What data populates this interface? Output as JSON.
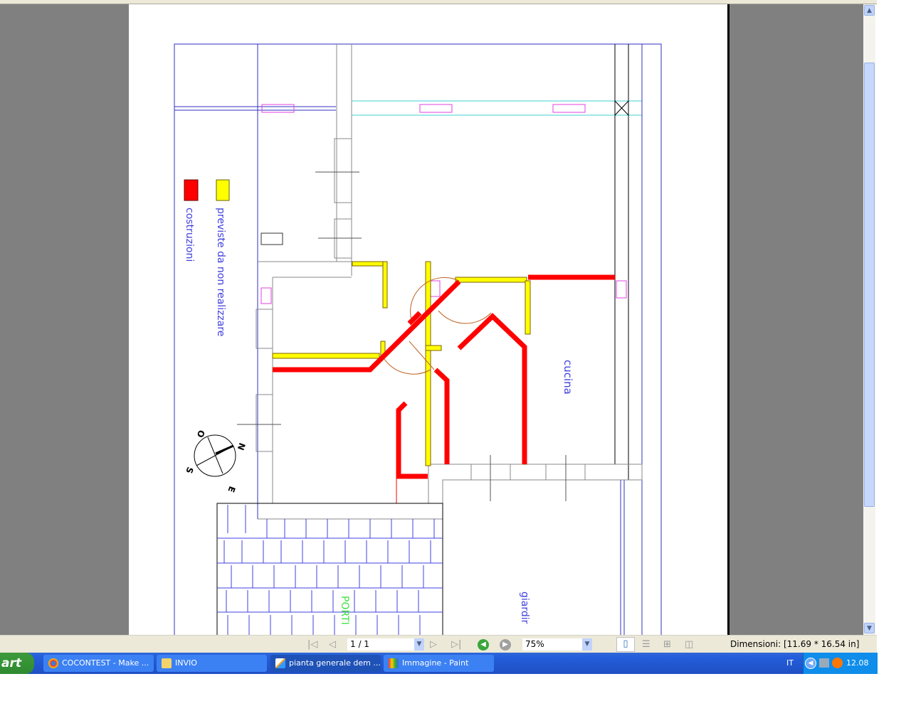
{
  "drawing": {
    "legend": [
      {
        "label": "costruzioni",
        "color": "#ff0000"
      },
      {
        "label": "previste da non realizzare",
        "color": "#ffff00"
      }
    ],
    "compass": {
      "north": "N",
      "south": "S",
      "east": "E",
      "west": "O"
    },
    "rooms": {
      "kitchen": "cucina",
      "garden": "giardir",
      "portico": "PORTI"
    }
  },
  "toolbar": {
    "page_field": "1 / 1",
    "zoom_field": "75%",
    "dimensions": "Dimensioni: [11.69 * 16.54 in]"
  },
  "taskbar": {
    "start_label": "art",
    "tasks": [
      {
        "label": "COCONTEST - Make ..."
      },
      {
        "label": "INVIO"
      },
      {
        "label": "pianta generale dem ..."
      },
      {
        "label": "Immagine - Paint"
      }
    ],
    "language": "IT",
    "clock": "12.08"
  }
}
